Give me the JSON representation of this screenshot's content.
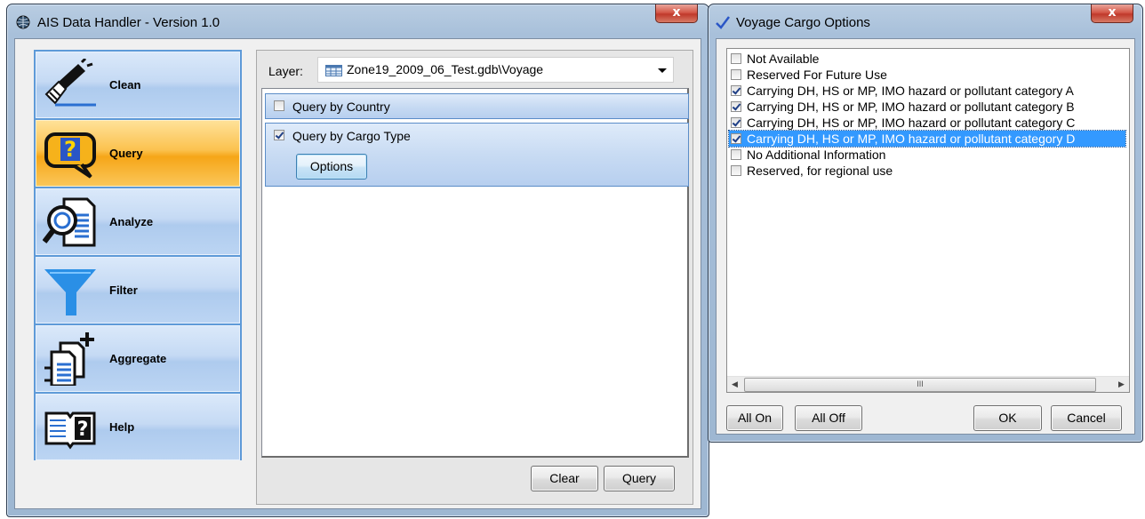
{
  "main_window": {
    "title": "AIS Data Handler - Version 1.0",
    "close_label": "x",
    "sidebar": {
      "items": [
        {
          "label": "Clean",
          "icon": "broom-icon",
          "active": false
        },
        {
          "label": "Query",
          "icon": "question-speech-icon",
          "active": true
        },
        {
          "label": "Analyze",
          "icon": "magnifier-document-icon",
          "active": false
        },
        {
          "label": "Filter",
          "icon": "funnel-icon",
          "active": false
        },
        {
          "label": "Aggregate",
          "icon": "add-documents-icon",
          "active": false
        },
        {
          "label": "Help",
          "icon": "book-question-icon",
          "active": false
        }
      ]
    },
    "layer": {
      "label": "Layer:",
      "value": "Zone19_2009_06_Test.gdb\\Voyage"
    },
    "queries": [
      {
        "label": "Query by Country",
        "checked": false
      },
      {
        "label": "Query by Cargo Type",
        "checked": true,
        "options_label": "Options"
      }
    ],
    "buttons": {
      "clear": "Clear",
      "query": "Query"
    }
  },
  "cargo_window": {
    "title": "Voyage Cargo Options",
    "close_label": "x",
    "items": [
      {
        "label": "Not Available",
        "checked": false,
        "selected": false
      },
      {
        "label": "Reserved For Future Use",
        "checked": false,
        "selected": false
      },
      {
        "label": "Carrying DH, HS or MP, IMO hazard or pollutant category A",
        "checked": true,
        "selected": false
      },
      {
        "label": "Carrying DH, HS or MP, IMO hazard or pollutant category B",
        "checked": true,
        "selected": false
      },
      {
        "label": "Carrying DH, HS or MP, IMO hazard or pollutant category C",
        "checked": true,
        "selected": false
      },
      {
        "label": "Carrying DH, HS or MP, IMO hazard or pollutant category D",
        "checked": true,
        "selected": true
      },
      {
        "label": "No Additional Information",
        "checked": false,
        "selected": false
      },
      {
        "label": "Reserved, for regional use",
        "checked": false,
        "selected": false
      }
    ],
    "scroll_thumb_grip": "III",
    "buttons": {
      "all_on": "All On",
      "all_off": "All Off",
      "ok": "OK",
      "cancel": "Cancel"
    }
  },
  "colors": {
    "accent_blue": "#3399ff",
    "active_orange": "#f6a618",
    "sidebar_border": "#5e9ad8"
  }
}
